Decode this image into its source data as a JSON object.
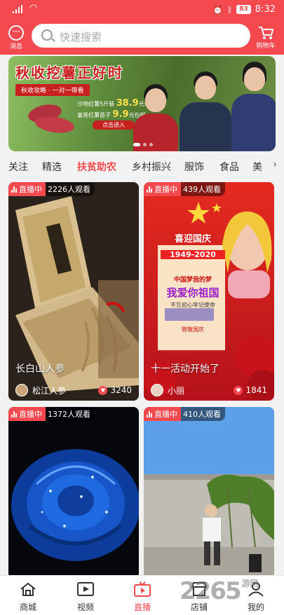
{
  "status_bar": {
    "signal": "46",
    "battery": "83",
    "time": "8:32"
  },
  "header": {
    "message_label": "消息",
    "search_placeholder": "快速搜索",
    "cart_label": "购物车"
  },
  "banner": {
    "title": "秋收挖薯正好时",
    "subtitle": "秋收攻略 · 一对一带看",
    "line1_prefix": "沙地红薯5斤装",
    "line1_price": "38.9",
    "line1_suffix": "元包邮",
    "line2_prefix": "富贵红薯苗子",
    "line2_price": "9.9",
    "line2_suffix": "元包邮",
    "enter_label": "点击进入"
  },
  "tabs": [
    {
      "label": "关注"
    },
    {
      "label": "精选"
    },
    {
      "label": "扶贫助农"
    },
    {
      "label": "乡村振兴"
    },
    {
      "label": "服饰"
    },
    {
      "label": "食品"
    },
    {
      "label": "美"
    }
  ],
  "cards": [
    {
      "live": "直播中",
      "viewers": "2226人观看",
      "title": "长白山人参",
      "author": "松江人参",
      "likes": "3240"
    },
    {
      "live": "直播中",
      "viewers": "439人观看",
      "title": "十一活动开始了",
      "author": "小丽",
      "likes": "1841",
      "poster_title": "喜迎国庆",
      "poster_years": "1949-2020",
      "poster_main": "我爱你祖国",
      "poster_sub": "不忘初心牢记使命",
      "poster_dream": "中国梦我的梦",
      "poster_extra": "致敬国庆"
    },
    {
      "live": "直播中",
      "viewers": "1372人观看"
    },
    {
      "live": "直播中",
      "viewers": "410人观看"
    }
  ],
  "bottom_nav": [
    {
      "label": "商城",
      "icon": "home-icon"
    },
    {
      "label": "视频",
      "icon": "video-icon"
    },
    {
      "label": "直播",
      "icon": "tv-icon"
    },
    {
      "label": "店铺",
      "icon": "store-icon"
    },
    {
      "label": "我的",
      "icon": "user-icon"
    }
  ],
  "watermark": {
    "text": "2265",
    "suffix": "游网"
  },
  "colors": {
    "accent": "#f44a4f"
  }
}
